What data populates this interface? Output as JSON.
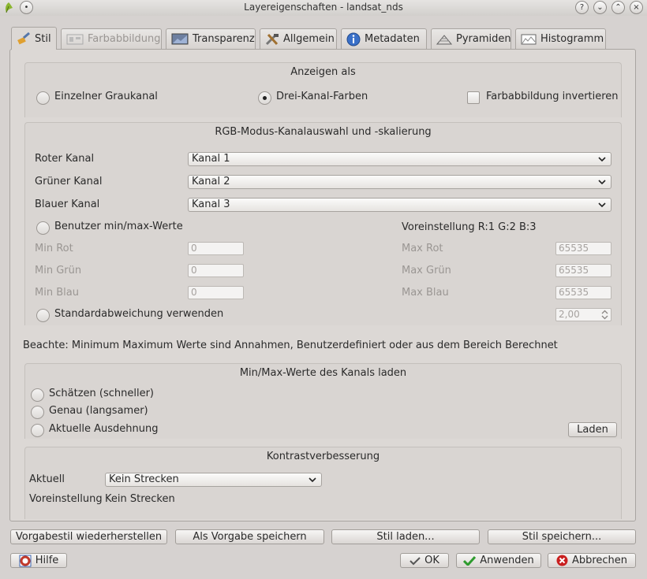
{
  "window": {
    "title": "Layereigenschaften - landsat_nds"
  },
  "tabs": [
    {
      "label": "Stil",
      "icon": "brush-icon"
    },
    {
      "label": "Farbabbildung",
      "icon": "colormap-icon"
    },
    {
      "label": "Transparenz",
      "icon": "transparency-icon"
    },
    {
      "label": "Allgemein",
      "icon": "tools-icon"
    },
    {
      "label": "Metadaten",
      "icon": "info-icon"
    },
    {
      "label": "Pyramiden",
      "icon": "pyramid-icon"
    },
    {
      "label": "Histogramm",
      "icon": "histogram-icon"
    }
  ],
  "display_as": {
    "title": "Anzeigen als",
    "single_gray": "Einzelner Graukanal",
    "three_band": "Drei-Kanal-Farben",
    "invert": "Farbabbildung invertieren"
  },
  "rgb": {
    "title": "RGB-Modus-Kanalauswahl und -skalierung",
    "red_label": "Roter Kanal",
    "red_value": "Kanal 1",
    "green_label": "Grüner Kanal",
    "green_value": "Kanal 2",
    "blue_label": "Blauer Kanal",
    "blue_value": "Kanal 3",
    "user_minmax": "Benutzer min/max-Werte",
    "preset": "Voreinstellung R:1 G:2 B:3",
    "min_red": "Min Rot",
    "min_green": "Min Grün",
    "min_blue": "Min Blau",
    "max_red": "Max Rot",
    "max_green": "Max Grün",
    "max_blue": "Max Blau",
    "min_value": "0",
    "max_value": "65535",
    "stddev": "Standardabweichung verwenden",
    "stddev_value": "2,00"
  },
  "note": "Beachte: Minimum Maximum Werte sind Annahmen, Benutzerdefiniert oder aus dem Bereich Berechnet",
  "load_minmax": {
    "title": "Min/Max-Werte des Kanals laden",
    "estimate": "Schätzen (schneller)",
    "exact": "Genau (langsamer)",
    "extent": "Aktuelle Ausdehnung",
    "load_button": "Laden"
  },
  "contrast": {
    "title": "Kontrastverbesserung",
    "current_label": "Aktuell",
    "current_value": "Kein Strecken",
    "preset_label": "Voreinstellung",
    "preset_value": "Kein Strecken"
  },
  "style_buttons": {
    "restore": "Vorgabestil wiederherstellen",
    "save_default": "Als Vorgabe speichern",
    "load": "Stil laden...",
    "save": "Stil speichern..."
  },
  "dialog_buttons": {
    "help": "Hilfe",
    "ok": "OK",
    "apply": "Anwenden",
    "cancel": "Abbrechen"
  }
}
